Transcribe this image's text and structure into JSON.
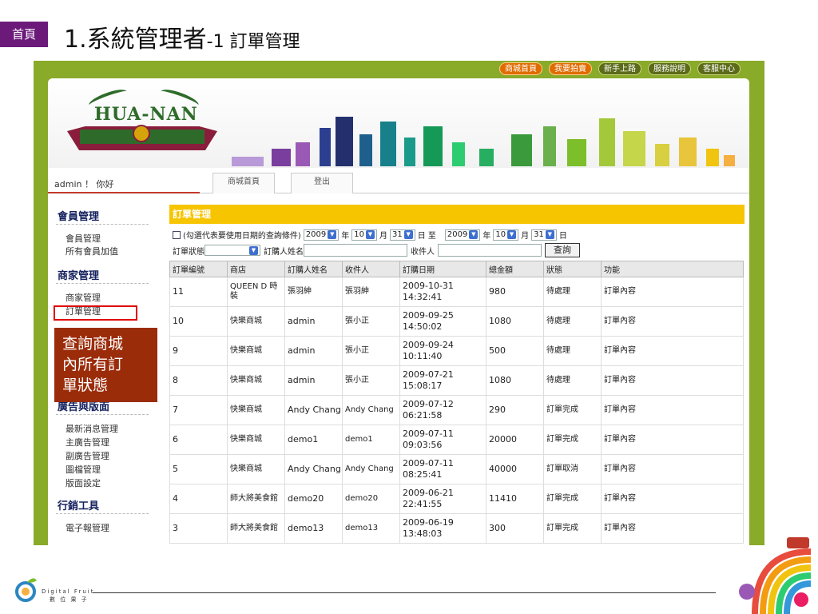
{
  "slide": {
    "home_tab": "首頁",
    "title_main": "1.系統管理者",
    "title_sub": "-1 訂單管理",
    "callout_lines": [
      "查詢商城",
      "內所有訂",
      "單狀態"
    ],
    "footer_brand": "Digital Fruit",
    "footer_brand_cn": "數 位 果 子"
  },
  "site": {
    "topnav": [
      "商城首頁",
      "我要拍賣",
      "新手上路",
      "服務說明",
      "客服中心"
    ],
    "logo_text": "HUA-NAN",
    "greeting": "admin ！ 你好",
    "tabs": [
      "商城首頁",
      "登出"
    ]
  },
  "sidebar": {
    "member_head": "會員管理",
    "member_items": [
      "會員管理",
      "所有會員加值"
    ],
    "shop_head": "商家管理",
    "shop_items": [
      "商家管理",
      "訂單管理"
    ],
    "ads_head": "廣告與版面",
    "ads_items": [
      "最新消息管理",
      "主廣告管理",
      "副廣告管理",
      "圖檔管理",
      "版面設定"
    ],
    "marketing_head": "行銷工具",
    "marketing_items": [
      "電子報管理"
    ]
  },
  "main": {
    "header": "訂單管理",
    "filter_checkbox_label": "(勾選代表要使用日期的查詢條件)",
    "from_year": "2009",
    "from_month": "10",
    "from_day": "31",
    "to_year": "2009",
    "to_month": "10",
    "to_day": "31",
    "lbl_year": "年",
    "lbl_month": "月",
    "lbl_day_to": "日 至",
    "lbl_day": "日",
    "status_label": "訂單狀態",
    "buyer_label": "訂購人姓名",
    "receiver_label": "收件人",
    "query_button": "查詢",
    "columns": [
      "訂單編號",
      "商店",
      "訂購人姓名",
      "收件人",
      "訂購日期",
      "總金額",
      "狀態",
      "功能"
    ],
    "rows": [
      [
        "11",
        "QUEEN D 時裝",
        "張羽紳",
        "張羽紳",
        "2009-10-31 14:32:41",
        "980",
        "待處理",
        "訂單內容"
      ],
      [
        "10",
        "快樂商城",
        "admin",
        "張小正",
        "2009-09-25 14:50:02",
        "1080",
        "待處理",
        "訂單內容"
      ],
      [
        "9",
        "快樂商城",
        "admin",
        "張小正",
        "2009-09-24 10:11:40",
        "500",
        "待處理",
        "訂單內容"
      ],
      [
        "8",
        "快樂商城",
        "admin",
        "張小正",
        "2009-07-21 15:08:17",
        "1080",
        "待處理",
        "訂單內容"
      ],
      [
        "7",
        "快樂商城",
        "Andy Chang",
        "Andy Chang",
        "2009-07-12 06:21:58",
        "290",
        "訂單完成",
        "訂單內容"
      ],
      [
        "6",
        "快樂商城",
        "demo1",
        "demo1",
        "2009-07-11 09:03:56",
        "20000",
        "訂單完成",
        "訂單內容"
      ],
      [
        "5",
        "快樂商城",
        "Andy Chang",
        "Andy Chang",
        "2009-07-11 08:25:41",
        "40000",
        "訂單取消",
        "訂單內容"
      ],
      [
        "4",
        "師大將美食館",
        "demo20",
        "demo20",
        "2009-06-21 22:41:55",
        "11410",
        "訂單完成",
        "訂單內容"
      ],
      [
        "3",
        "師大將美食館",
        "demo13",
        "demo13",
        "2009-06-19 13:48:03",
        "300",
        "訂單完成",
        "訂單內容"
      ]
    ]
  },
  "colors": {
    "home_tab": "#6b1a7a",
    "frame_green": "#8aaa2a",
    "header_yellow": "#f7c400",
    "sidebar_heading": "#14215e",
    "callout": "#9b2c0a",
    "highlight_box": "#e00000"
  }
}
